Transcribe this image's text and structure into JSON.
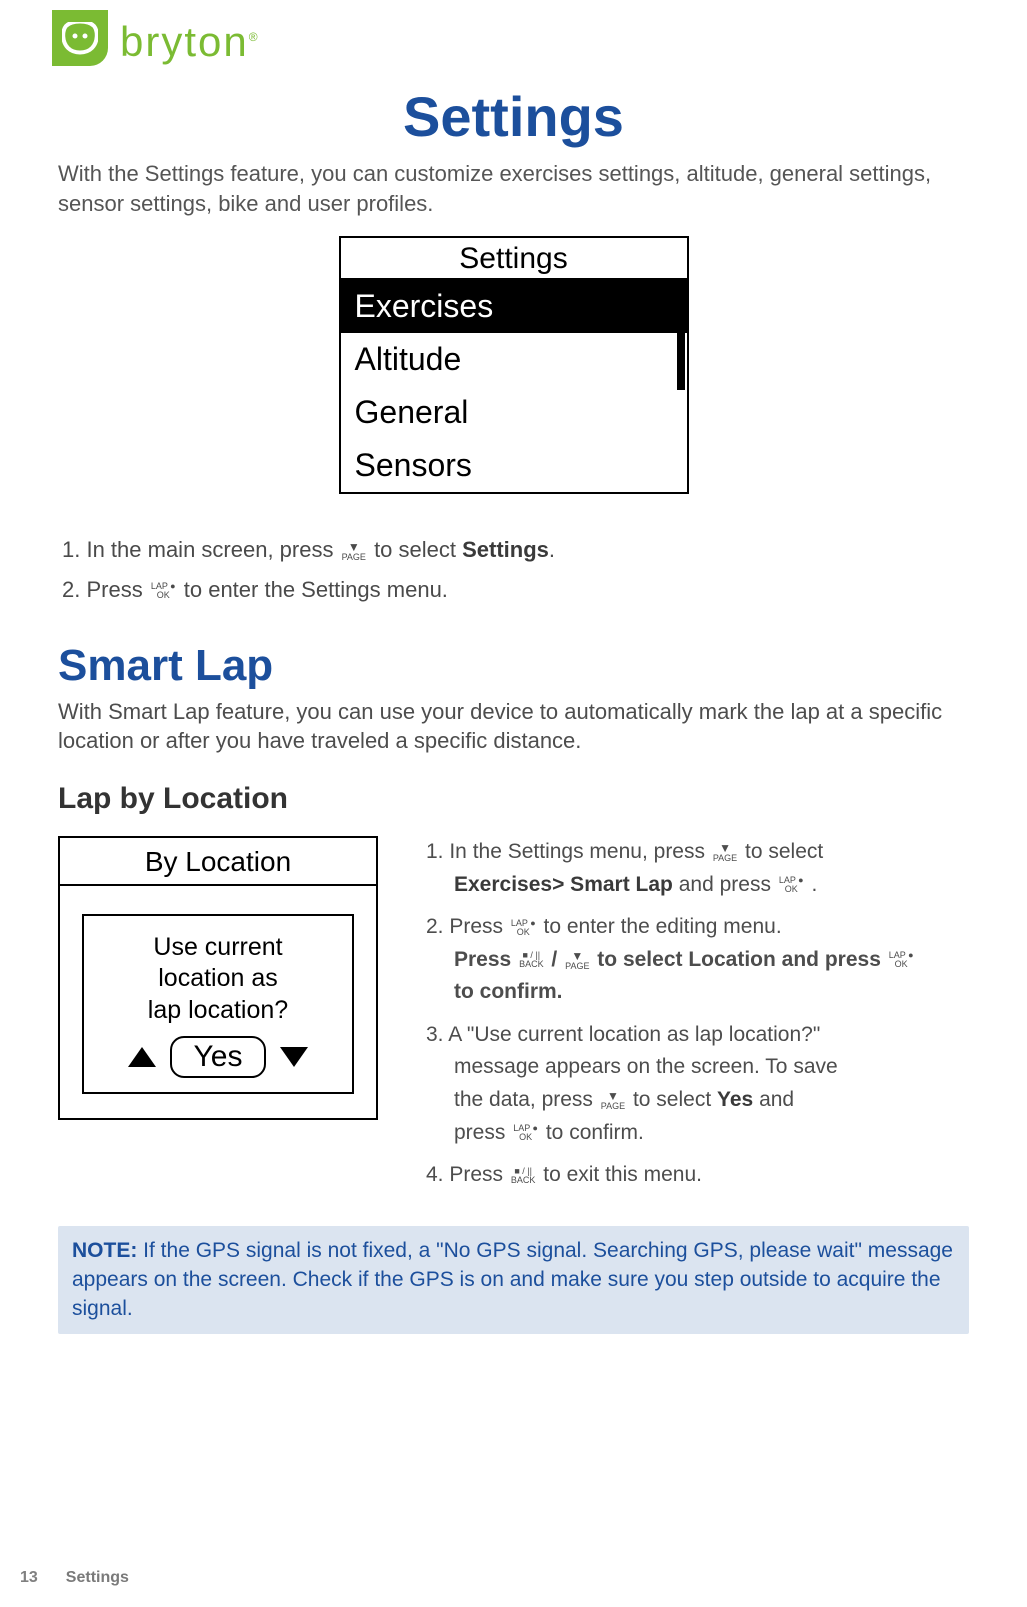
{
  "brand": "bryton",
  "page_title": "Settings",
  "intro": "With the Settings feature, you can customize exercises settings, altitude, general settings, sensor settings, bike and user profiles.",
  "device_screen1": {
    "title": "Settings",
    "items": [
      "Exercises",
      "Altitude",
      "General",
      "Sensors"
    ],
    "selected_index": 0
  },
  "steps1": {
    "s1_a": "1.  In the main screen, press",
    "s1_b": "to select",
    "s1_c": "Settings",
    "s1_d": ".",
    "s2_a": "2.  Press",
    "s2_b": "to enter the Settings menu."
  },
  "smart_lap_heading": "Smart Lap",
  "smart_lap_intro": "With Smart Lap feature, you can use your device to automatically mark the lap at a specific location or after you have traveled a specific distance.",
  "lap_loc_heading": "Lap by Location",
  "device_screen2": {
    "title": "By Location",
    "prompt_l1": "Use current",
    "prompt_l2": "location as",
    "prompt_l3": "lap location?",
    "answer": "Yes"
  },
  "steps2": {
    "r1_a": "1.  In the Settings menu, press",
    "r1_b": "to select",
    "r1_c": "Exercises> Smart Lap",
    "r1_d": "and press",
    "r1_e": ".",
    "r2_a": "2.  Press",
    "r2_b": "to enter the editing menu.",
    "r2_sub_a": "Press",
    "r2_sub_b": "/",
    "r2_sub_c": "to select  Location and press",
    "r2_sub_d": "to confirm.",
    "r3_a": "3.  A \"Use current location as lap location?\"",
    "r3_b": "message appears on the screen. To save",
    "r3_c": "the data, press",
    "r3_d": "to select",
    "r3_e": "Yes",
    "r3_f": "and",
    "r3_g": "press",
    "r3_h": "to confirm.",
    "r4_a": "4.  Press",
    "r4_b": "to exit this menu."
  },
  "note_label": "NOTE:",
  "note_text": "If the GPS signal is not fixed, a \"No GPS signal. Searching GPS, please wait\" message appears on the screen. Check if the GPS is on and make sure you step outside to acquire the signal.",
  "footer_page": "13",
  "footer_section": "Settings",
  "icons": {
    "page_down": {
      "top": "▼",
      "bottom": "PAGE"
    },
    "lap_ok": {
      "top": "LAP ●",
      "bottom": "OK"
    },
    "back": {
      "top": "■ / ||",
      "bottom": "BACK"
    }
  }
}
